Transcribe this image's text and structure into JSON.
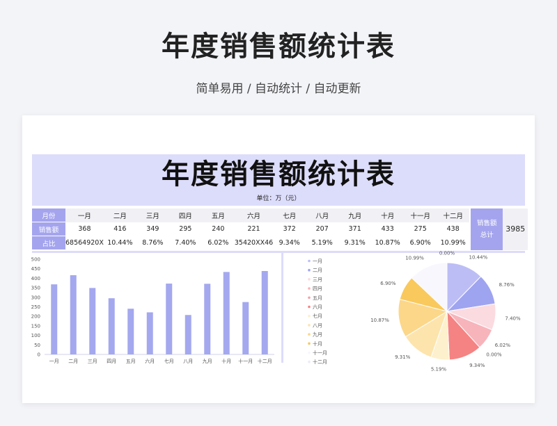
{
  "header": {
    "title": "年度销售额统计表",
    "subtitle": "简单易用 / 自动统计 / 自动更新"
  },
  "sheet": {
    "title": "年度销售额统计表",
    "unit": "单位：万（元）",
    "row_labels": [
      "月份",
      "销售额",
      "占比"
    ],
    "months": [
      "一月",
      "二月",
      "三月",
      "四月",
      "五月",
      "六月",
      "七月",
      "八月",
      "九月",
      "十月",
      "十一月",
      "十二月"
    ],
    "sales": [
      "368",
      "416",
      "349",
      "295",
      "240",
      "221",
      "372",
      "207",
      "371",
      "433",
      "275",
      "438"
    ],
    "ratios": [
      "68564920X",
      "10.44%",
      "8.76%",
      "7.40%",
      "6.02%",
      "35420XX46",
      "9.34%",
      "5.19%",
      "9.31%",
      "10.87%",
      "6.90%",
      "10.99%"
    ],
    "total_label_1": "销售额",
    "total_label_2": "总计",
    "total_value": "3985"
  },
  "chart_data": [
    {
      "type": "bar",
      "categories": [
        "一月",
        "二月",
        "三月",
        "四月",
        "五月",
        "六月",
        "七月",
        "八月",
        "九月",
        "十月",
        "十一月",
        "十二月"
      ],
      "values": [
        368,
        416,
        349,
        295,
        240,
        221,
        372,
        207,
        371,
        433,
        275,
        438
      ],
      "ylim": [
        0,
        500
      ],
      "yticks": [
        "0",
        "50",
        "100",
        "150",
        "200",
        "250",
        "300",
        "350",
        "400",
        "450",
        "500"
      ],
      "grid": false,
      "color": "#a4a8ee"
    },
    {
      "type": "pie",
      "categories": [
        "一月",
        "二月",
        "三月",
        "四月",
        "五月",
        "六月",
        "七月",
        "八月",
        "九月",
        "十月",
        "十一月",
        "十二月"
      ],
      "percents": [
        10.44,
        8.76,
        7.4,
        6.02,
        0.0,
        9.34,
        5.19,
        9.31,
        10.87,
        6.9,
        10.99,
        0.0
      ],
      "labels": [
        "10.44%",
        "8.76%",
        "7.40%",
        "6.02%",
        "0.00%",
        "9.34%",
        "5.19%",
        "9.31%",
        "10.87%",
        "6.90%",
        "10.99%",
        "0.00%"
      ],
      "colors": [
        "#bdbdf6",
        "#9fa4f0",
        "#fbdbe0",
        "#f8b4bb",
        "#f6a0a8",
        "#f58383",
        "#fdf0cc",
        "#fde4ad",
        "#fcd78a",
        "#f9c95d",
        "#f7f7fd",
        "#ececf7"
      ],
      "legend_position": "left"
    }
  ]
}
